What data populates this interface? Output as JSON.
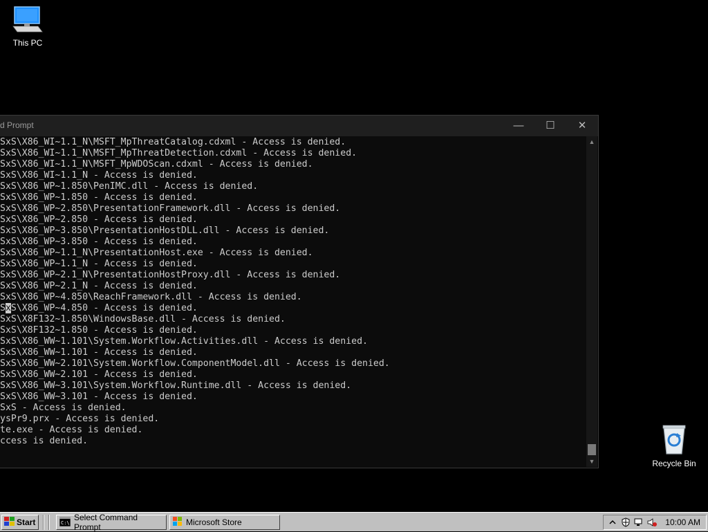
{
  "desktop": {
    "this_pc_label": "This PC",
    "recycle_bin_label": "Recycle Bin"
  },
  "window": {
    "title": "d Prompt",
    "minimize": "—",
    "maximize": "☐",
    "close": "✕"
  },
  "console": {
    "lines": [
      "SxS\\X86_WI~1.1_N\\MSFT_MpThreatCatalog.cdxml - Access is denied.",
      "SxS\\X86_WI~1.1_N\\MSFT_MpThreatDetection.cdxml - Access is denied.",
      "SxS\\X86_WI~1.1_N\\MSFT_MpWDOScan.cdxml - Access is denied.",
      "SxS\\X86_WI~1.1_N - Access is denied.",
      "SxS\\X86_WP~1.850\\PenIMC.dll - Access is denied.",
      "SxS\\X86_WP~1.850 - Access is denied.",
      "SxS\\X86_WP~2.850\\PresentationFramework.dll - Access is denied.",
      "SxS\\X86_WP~2.850 - Access is denied.",
      "SxS\\X86_WP~3.850\\PresentationHostDLL.dll - Access is denied.",
      "SxS\\X86_WP~3.850 - Access is denied.",
      "SxS\\X86_WP~1.1_N\\PresentationHost.exe - Access is denied.",
      "SxS\\X86_WP~1.1_N - Access is denied.",
      "SxS\\X86_WP~2.1_N\\PresentationHostProxy.dll - Access is denied.",
      "SxS\\X86_WP~2.1_N - Access is denied.",
      "SxS\\X86_WP~4.850\\ReachFramework.dll - Access is denied.",
      "SxS\\X86_WP~4.850 - Access is denied.",
      "SxS\\X8F132~1.850\\WindowsBase.dll - Access is denied.",
      "SxS\\X8F132~1.850 - Access is denied.",
      "SxS\\X86_WW~1.101\\System.Workflow.Activities.dll - Access is denied.",
      "SxS\\X86_WW~1.101 - Access is denied.",
      "SxS\\X86_WW~2.101\\System.Workflow.ComponentModel.dll - Access is denied.",
      "SxS\\X86_WW~2.101 - Access is denied.",
      "SxS\\X86_WW~3.101\\System.Workflow.Runtime.dll - Access is denied.",
      "SxS\\X86_WW~3.101 - Access is denied.",
      "SxS - Access is denied.",
      "ysPr9.prx - Access is denied.",
      "te.exe - Access is denied.",
      "ccess is denied."
    ],
    "cursor_line": 15,
    "cursor_col": 1
  },
  "taskbar": {
    "start_label": "Start",
    "tasks": [
      {
        "label": "Select Command Prompt"
      },
      {
        "label": "Microsoft Store"
      }
    ],
    "clock": "10:00 AM"
  },
  "colors": {
    "console_bg": "#0c0c0c",
    "console_text": "#cccccc",
    "taskbar_bg": "#c0c0c0",
    "desktop_bg": "#000000"
  }
}
